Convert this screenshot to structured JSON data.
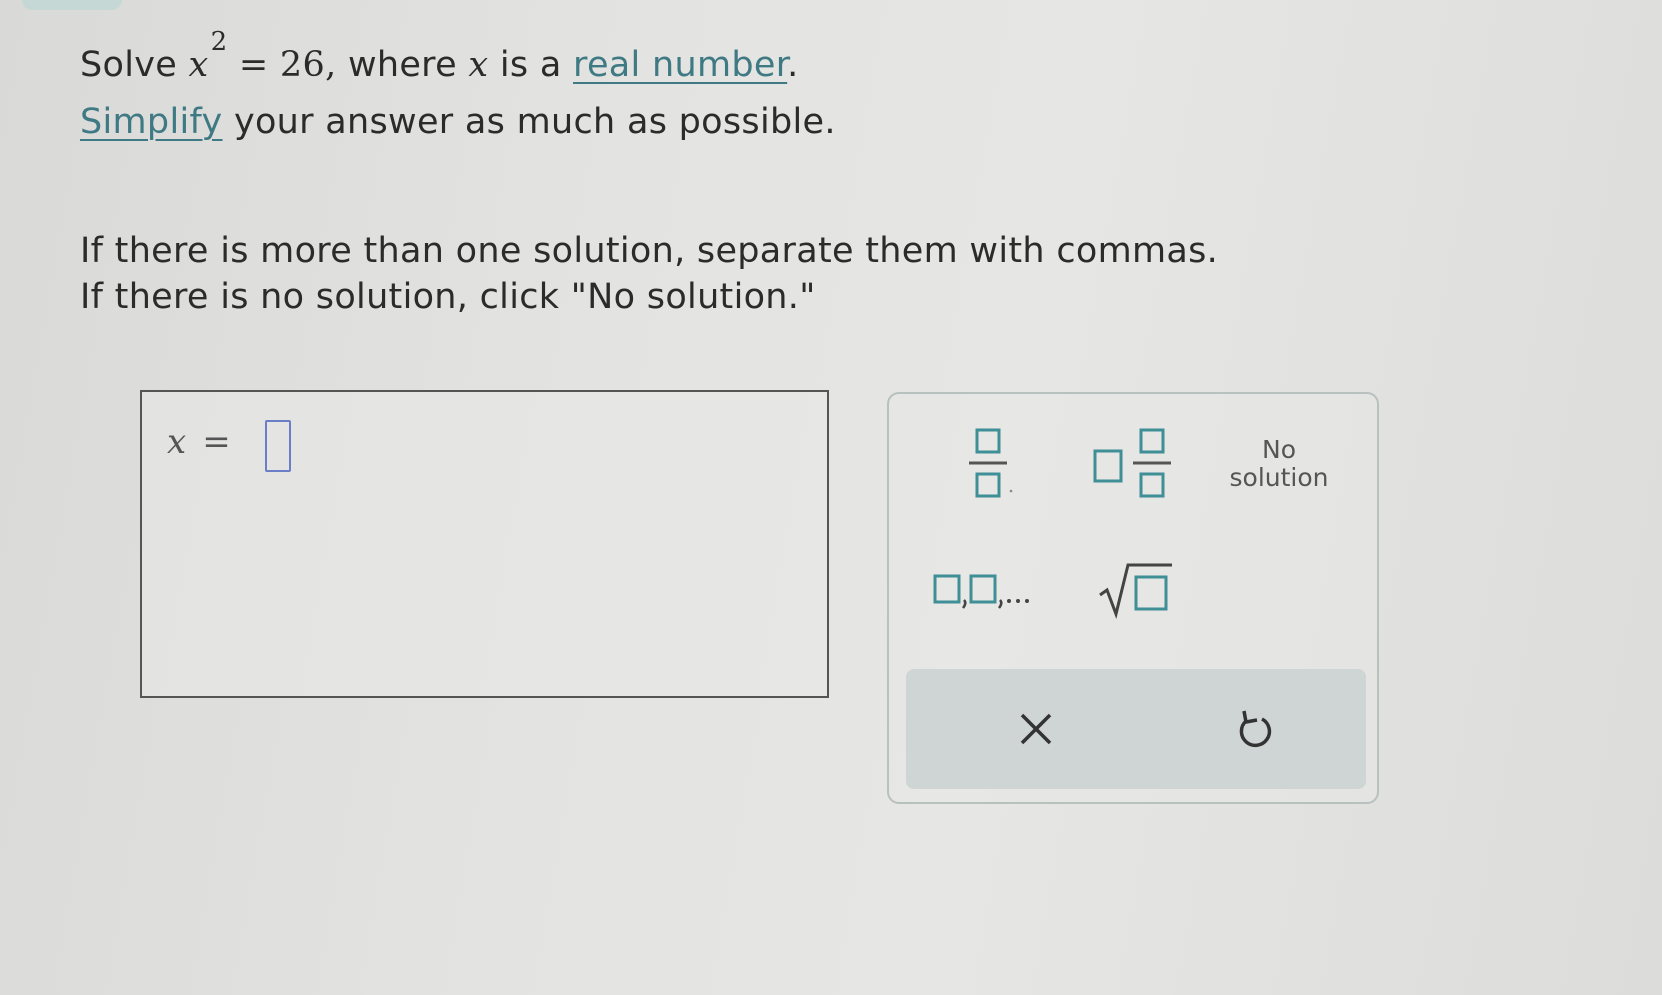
{
  "colors": {
    "accent_teal": "#3f8f96",
    "input_border": "#6a7fc7",
    "link": "#3f7a84"
  },
  "question": {
    "solve_word": "Solve",
    "var_x": "x",
    "exponent": "2",
    "equals_value": "= 26,",
    "where_text": "where",
    "is_a_text": "is a",
    "real_number_link": "real number",
    "period": ".",
    "simplify_link": "Simplify",
    "simplify_rest": " your answer as much as possible."
  },
  "instructions": {
    "line1": "If there is more than one solution, separate them with commas.",
    "line2": "If there is no solution, click \"No solution.\""
  },
  "answer": {
    "var": "x",
    "equals": "=",
    "value": ""
  },
  "keypad": {
    "fraction_icon": "fraction-icon",
    "mixed_number_icon": "mixed-number-icon",
    "no_solution_line1": "No",
    "no_solution_line2": "solution",
    "list_icon": "comma-list-icon",
    "sqrt_icon": "square-root-icon",
    "clear_icon": "x-clear-icon",
    "undo_icon": "undo-icon"
  }
}
